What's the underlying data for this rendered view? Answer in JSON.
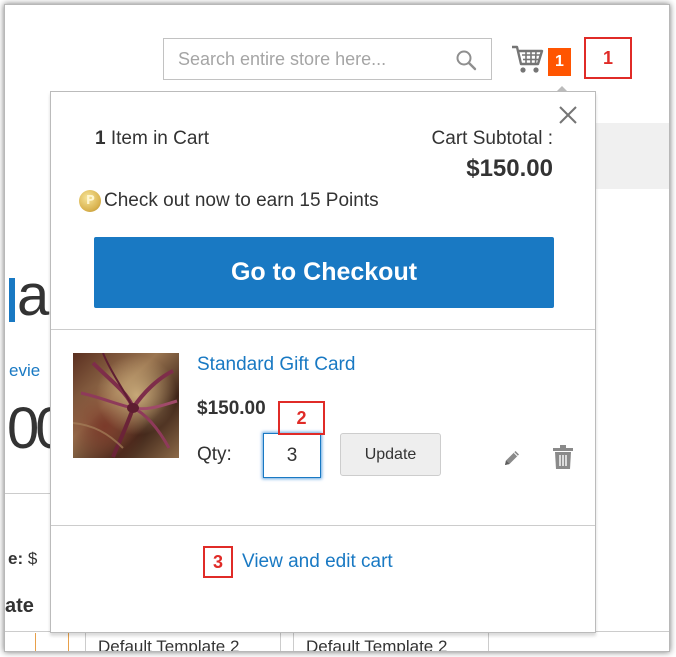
{
  "header": {
    "search_placeholder": "Search entire store here...",
    "cart_count": "1"
  },
  "background": {
    "heading_fragment": "a",
    "reviews_fragment": "evie",
    "price_fragment": "00",
    "price_label": "e:",
    "price_currency": "$",
    "tab_fragment": "ate",
    "select_options": [
      "",
      "Default Template 2",
      "Default Template 2"
    ]
  },
  "minicart": {
    "items_count": "1",
    "items_label": "Item in Cart",
    "subtotal_label": "Cart Subtotal :",
    "subtotal_value": "$150.00",
    "points_text": "Check out now to earn 15 Points",
    "checkout_label": "Go to Checkout",
    "item": {
      "name": "Standard Gift Card",
      "price": "$150.00",
      "qty_label": "Qty:",
      "qty_value": "3",
      "update_label": "Update"
    },
    "view_cart_label": "View and edit cart"
  },
  "callouts": [
    "1",
    "2",
    "3"
  ],
  "colors": {
    "accent": "#1979c3",
    "cart_badge": "#ff5501",
    "callout": "#e02b27"
  }
}
